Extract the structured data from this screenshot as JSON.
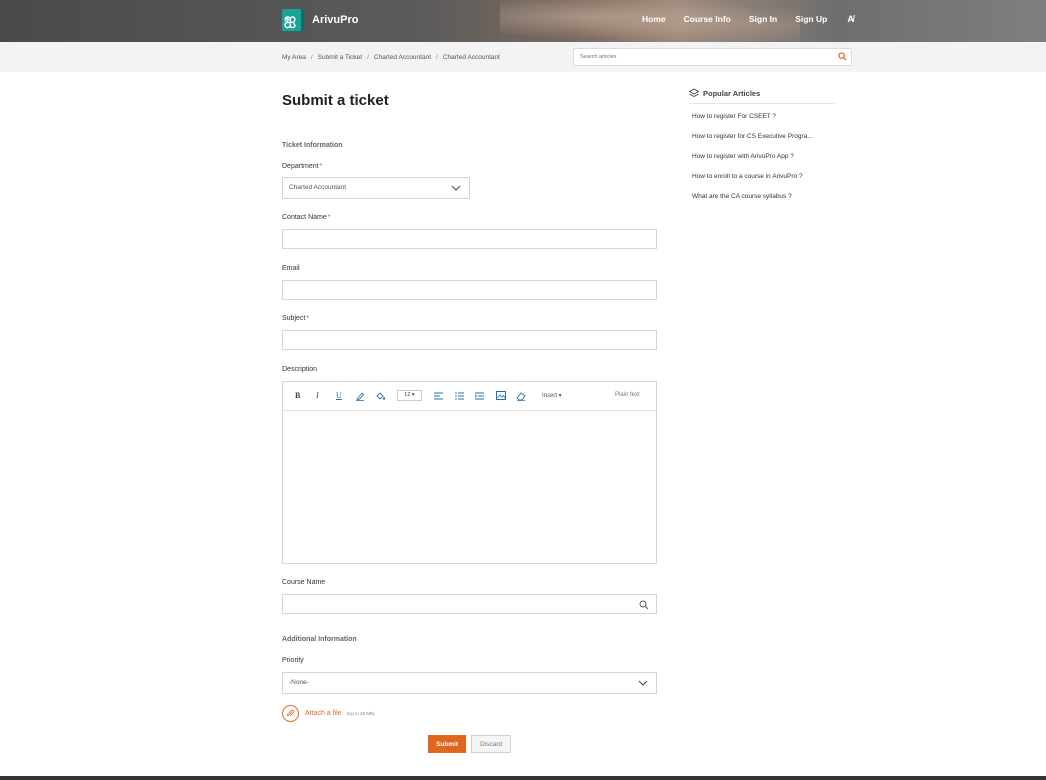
{
  "header": {
    "brand": "ArivuPro",
    "logo_glyph": "ஐ",
    "nav": [
      "Home",
      "Course Info",
      "Sign In",
      "Sign Up"
    ],
    "lang_icon": "A̸",
    "brand_color": "#1aa39a"
  },
  "breadcrumb": [
    "My Area",
    "Submit a Ticket",
    "Charted Accountant",
    "Charted Accountant"
  ],
  "search": {
    "placeholder": "Search articles"
  },
  "form": {
    "title": "Submit a ticket",
    "ticket_info_title": "Ticket Information",
    "department_label": "Department",
    "department_value": "Charted Accountant",
    "contact_label": "Contact Name",
    "email_label": "Email",
    "subject_label": "Subject",
    "description_label": "Description",
    "editor": {
      "bold": "B",
      "italic": "I",
      "underline": "U",
      "font_size": "12 ▾",
      "insert": "Insert ▾",
      "plain_text": "Plain text"
    },
    "course_label": "Course Name",
    "additional_title": "Additional Information",
    "priority_label": "Priority",
    "priority_value": "-None-",
    "attach_label": "Attach a file",
    "attach_limit": "(Up to 20 MB)",
    "submit": "Submit",
    "discard": "Discard",
    "required_mark": "*"
  },
  "sidebar": {
    "title": "Popular Articles",
    "articles": [
      "How to register For CSEET ?",
      "How to register for CS Executive Progra...",
      "How to register with ArivuPro App ?",
      "How to enroll to a course in ArivuPro ?",
      "What are the CA course syllabus ?"
    ]
  },
  "colors": {
    "accent": "#e0661e",
    "required": "#e04a26"
  }
}
